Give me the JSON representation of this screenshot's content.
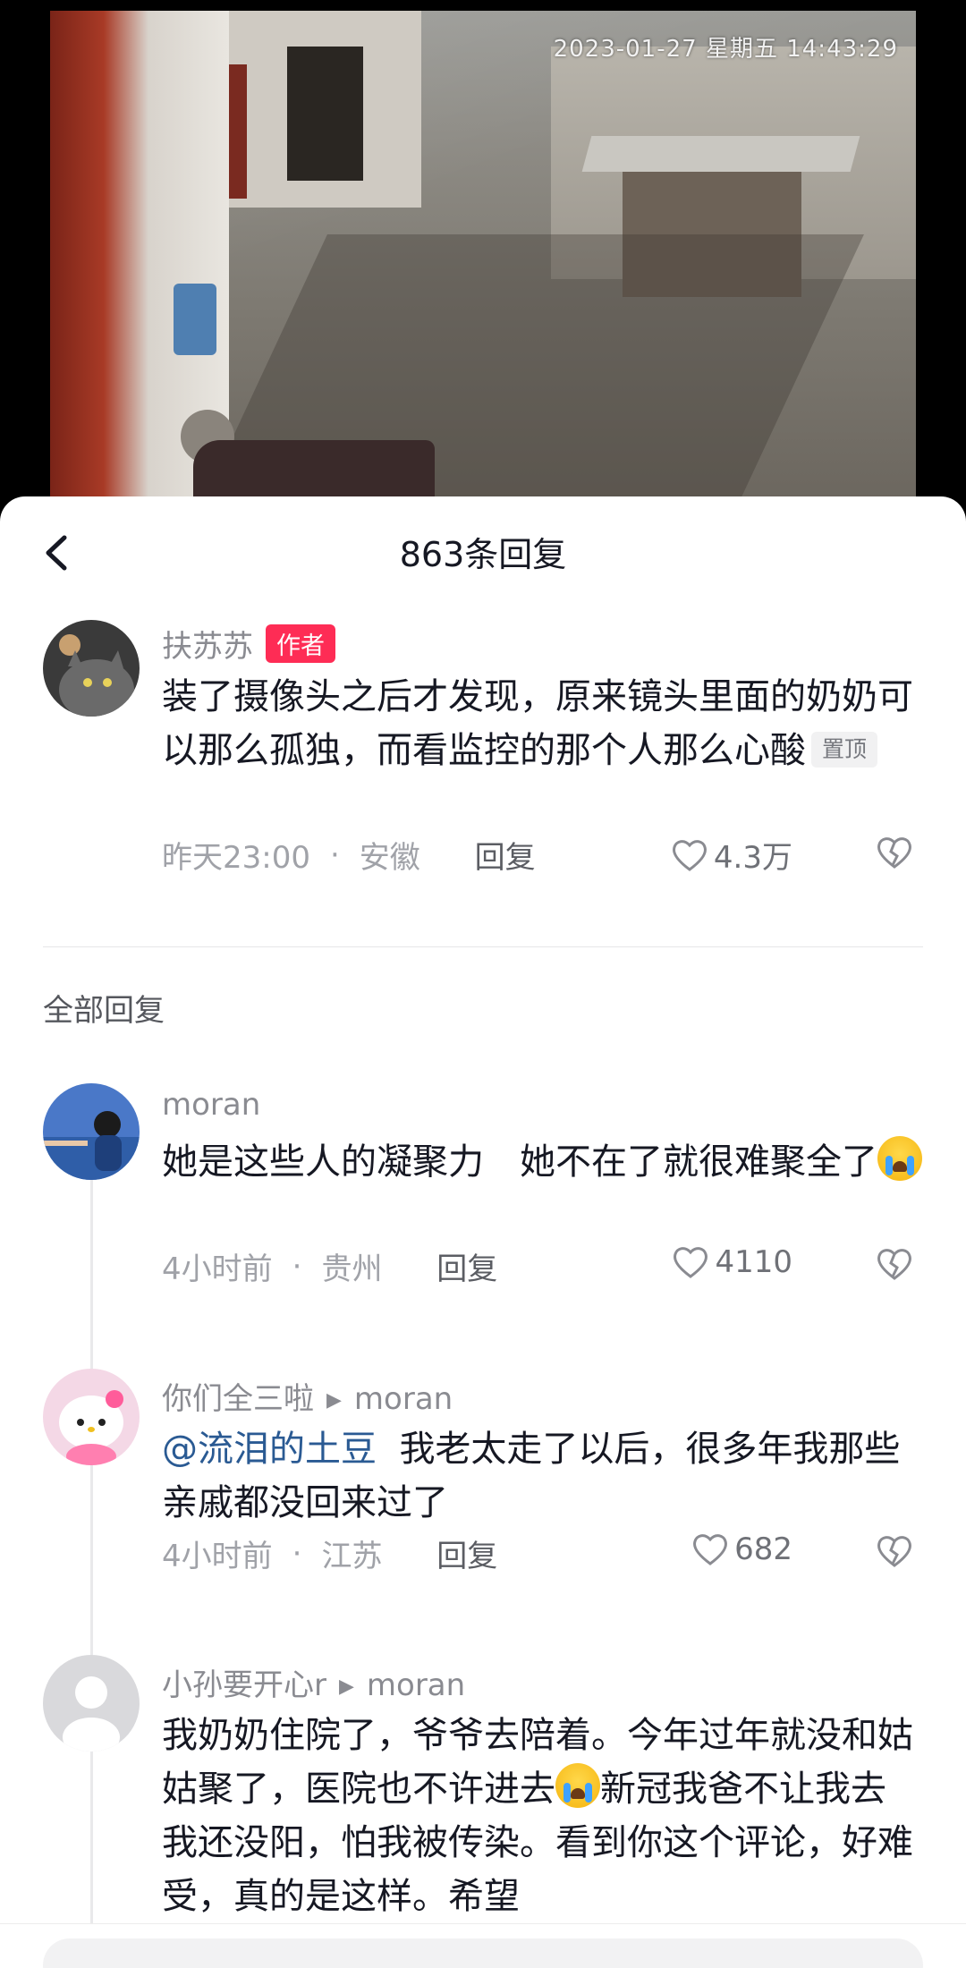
{
  "video": {
    "timestamp": "2023-01-27  星期五  14:43:29"
  },
  "sheet": {
    "title": "863条回复"
  },
  "pinned_comment": {
    "username": "扶苏苏",
    "author_badge": "作者",
    "text": "装了摄像头之后才发现，原来镜头里面的奶奶可以那么孤独，而看监控的那个人那么心酸",
    "pin_tag": "置顶",
    "time": "昨天23:00",
    "location": "安徽",
    "reply_label": "回复",
    "likes": "4.3万",
    "avatar_icon": "cat-photo-avatar"
  },
  "section": {
    "title": "全部回复"
  },
  "replies": [
    {
      "username": "moran",
      "text": "她是这些人的凝聚力　她不在了就很难聚全了",
      "emoji": "crying-face",
      "time": "4小时前",
      "location": "贵州",
      "reply_label": "回复",
      "likes": "4110"
    },
    {
      "username": "你们全三啦",
      "reply_to": "moran",
      "mention": "@流泪的土豆",
      "text": "我老太走了以后，很多年我那些亲戚都没回来过了",
      "time": "4小时前",
      "location": "江苏",
      "reply_label": "回复",
      "likes": "682"
    },
    {
      "username": "小孙要开心r",
      "reply_to": "moran",
      "text_part1": "我奶奶住院了，爷爷去陪着。今年过年就没和姑姑聚了，医院也不许进去",
      "text_part2": "新冠我爸不让我去 我还没阳，怕我被传染。看到你这个评论，好难受，真的是这样。希望"
    }
  ],
  "colors": {
    "accent": "#fe2c55",
    "mention": "#2a5a93",
    "text": "#161823",
    "muted": "#8a8b91"
  }
}
